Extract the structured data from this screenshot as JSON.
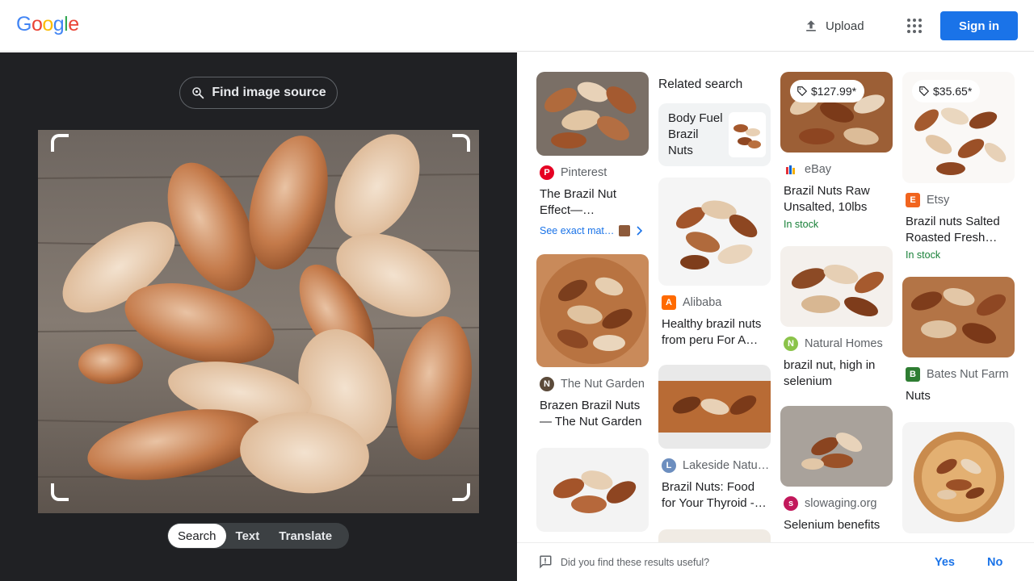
{
  "header": {
    "logo_letters": [
      {
        "ch": "G",
        "color": "#4285F4"
      },
      {
        "ch": "o",
        "color": "#EA4335"
      },
      {
        "ch": "o",
        "color": "#FBBC05"
      },
      {
        "ch": "g",
        "color": "#4285F4"
      },
      {
        "ch": "l",
        "color": "#34A853"
      },
      {
        "ch": "e",
        "color": "#EA4335"
      }
    ],
    "upload_label": "Upload",
    "upload_icon": "upload-icon",
    "apps_icon": "apps-grid-icon",
    "signin_label": "Sign in"
  },
  "left": {
    "find_source_label": "Find image source",
    "tabs": [
      "Search",
      "Text",
      "Translate"
    ],
    "active_tab": "Search"
  },
  "results": {
    "col1": [
      {
        "source": "Pinterest",
        "title": "The Brazil Nut Effect— “granular…",
        "exact": "See exact mat…",
        "fav_color": "#E60023",
        "fav_letter": "P"
      },
      {
        "source": "The Nut Garden",
        "title": "Brazen Brazil Nuts — The Nut Garden",
        "fav_color": "#5b4a3a",
        "fav_letter": "N"
      }
    ],
    "related": {
      "heading": "Related search",
      "card": "Body Fuel Brazil Nuts"
    },
    "col2": [
      {
        "source": "Alibaba",
        "title": "Healthy brazil nuts from peru For A…",
        "fav_color": "#FF6A00",
        "fav_letter": "A"
      },
      {
        "source": "Lakeside Natu…",
        "title": "Brazil Nuts: Food for Your Thyroid -…",
        "fav_color": "#6c8ebf",
        "fav_letter": "L"
      }
    ],
    "col3": [
      {
        "price": "$127.99*",
        "source": "eBay",
        "title": "Brazil Nuts Raw Unsalted, 10lbs",
        "stock": "In stock",
        "fav_color": "#0064D2",
        "fav_letter": "e"
      },
      {
        "source": "Natural Homes",
        "title": "brazil nut, high in selenium",
        "fav_color": "#8bc34a",
        "fav_letter": "N"
      },
      {
        "source": "slowaging.org",
        "title": "Selenium benefits",
        "fav_color": "#c2185b",
        "fav_letter": "s"
      }
    ],
    "col4": [
      {
        "price": "$35.65*",
        "source": "Etsy",
        "title": "Brazil nuts Salted Roasted Fresh Nu…",
        "stock": "In stock",
        "fav_color": "#F1641E",
        "fav_letter": "E"
      },
      {
        "source": "Bates Nut Farm",
        "title": "Nuts",
        "fav_color": "#2e7d32",
        "fav_letter": "B"
      }
    ]
  },
  "feedback": {
    "question": "Did you find these results useful?",
    "yes": "Yes",
    "no": "No"
  }
}
